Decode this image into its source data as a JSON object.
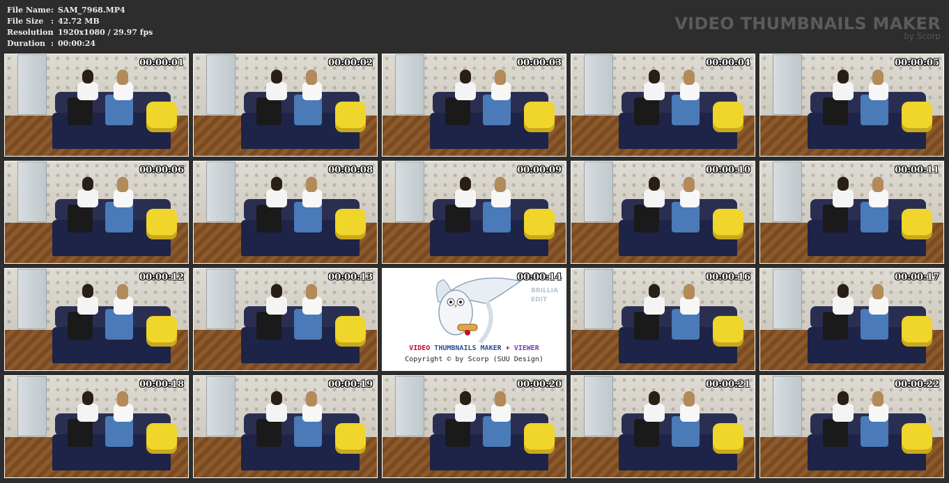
{
  "info": {
    "rows": [
      {
        "label": "File Name",
        "sep": ":",
        "value": "SAM_7968.MP4"
      },
      {
        "label": "File Size",
        "sep": ":",
        "value": "42.72 MB"
      },
      {
        "label": "Resolution",
        "sep": ":",
        "value": "1920x1080 / 29.97 fps"
      },
      {
        "label": "Duration",
        "sep": ":",
        "value": "00:00:24"
      }
    ]
  },
  "brand": {
    "title": "VIDEO THUMBNAILS MAKER",
    "subtitle": "by Scorp"
  },
  "thumbnails": [
    "00:00:01",
    "00:00:02",
    "00:00:03",
    "00:00:04",
    "00:00:05",
    "00:00:06",
    "00:00:08",
    "00:00:09",
    "00:00:10",
    "00:00:11",
    "00:00:12",
    "00:00:13",
    "00:00:14",
    "00:00:16",
    "00:00:17",
    "00:00:18",
    "00:00:19",
    "00:00:20",
    "00:00:21",
    "00:00:22"
  ],
  "logo": {
    "part1": "VIDEO ",
    "part2": "THUMBNAILS MAKER",
    "part3": " + ",
    "part4": "VIEWER",
    "copyright": "Copyright © by Scorp (SUU Design)",
    "side1": "BRILLIA",
    "side2": "EDIT"
  },
  "colors": {
    "background": "#2d2d2d",
    "logo_red": "#c0102a",
    "logo_blue": "#2f4f8f",
    "logo_purple": "#7a3fb0"
  }
}
